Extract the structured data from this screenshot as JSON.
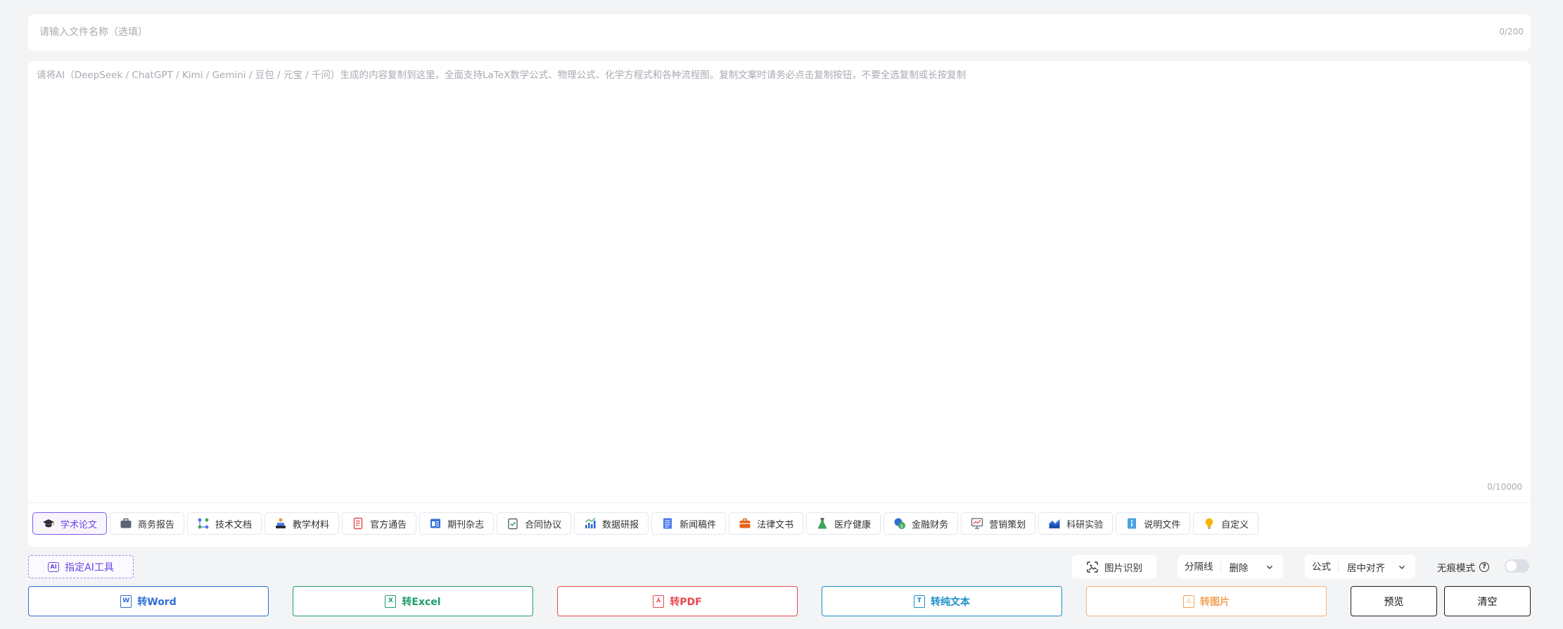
{
  "filename": {
    "placeholder": "请输入文件名称（选填）",
    "value": "",
    "counter": "0/200"
  },
  "content": {
    "placeholder": "请将AI（DeepSeek / ChatGPT / Kimi / Gemini / 豆包 / 元宝 / 千问）生成的内容复制到这里，全面支持LaTeX数学公式、物理公式、化学方程式和各种流程图。复制文案时请务必点击复制按钮，不要全选复制或长按复制",
    "value": "",
    "counter": "0/10000"
  },
  "templates": [
    {
      "label": "学术论文",
      "icon": "graduation-cap-icon",
      "active": true
    },
    {
      "label": "商务报告",
      "icon": "briefcase-icon",
      "active": false
    },
    {
      "label": "技术文档",
      "icon": "nodes-icon",
      "active": false
    },
    {
      "label": "教学材料",
      "icon": "podium-icon",
      "active": false
    },
    {
      "label": "官方通告",
      "icon": "notice-icon",
      "active": false
    },
    {
      "label": "期刊杂志",
      "icon": "magazine-icon",
      "active": false
    },
    {
      "label": "合同协议",
      "icon": "clipboard-check-icon",
      "active": false
    },
    {
      "label": "数据研报",
      "icon": "bar-chart-icon",
      "active": false
    },
    {
      "label": "新闻稿件",
      "icon": "newspaper-icon",
      "active": false
    },
    {
      "label": "法律文书",
      "icon": "legal-case-icon",
      "active": false
    },
    {
      "label": "医疗健康",
      "icon": "flask-icon",
      "active": false
    },
    {
      "label": "金融财务",
      "icon": "coins-icon",
      "active": false
    },
    {
      "label": "营销策划",
      "icon": "presentation-icon",
      "active": false
    },
    {
      "label": "科研实验",
      "icon": "area-chart-icon",
      "active": false
    },
    {
      "label": "说明文件",
      "icon": "info-doc-icon",
      "active": false
    },
    {
      "label": "自定义",
      "icon": "lightbulb-icon",
      "active": false
    }
  ],
  "controls": {
    "ai_tool_label": "指定AI工具",
    "ai_badge": "AI",
    "ocr_label": "图片识别",
    "divider_label": "分隔线",
    "divider_value": "删除",
    "formula_label": "公式",
    "formula_value": "居中对齐",
    "trace_mode_label": "无痕模式",
    "trace_mode_on": false
  },
  "convert": {
    "word": {
      "label": "转Word",
      "badge": "W",
      "color": "#2f6fd6"
    },
    "excel": {
      "label": "转Excel",
      "badge": "X",
      "color": "#1f9d6b"
    },
    "pdf": {
      "label": "转PDF",
      "badge": "⅄",
      "color": "#e5484d"
    },
    "text": {
      "label": "转纯文本",
      "badge": "T",
      "color": "#1b8fc9"
    },
    "image": {
      "label": "转图片",
      "badge": "◬",
      "color": "#f3a255"
    }
  },
  "actions": {
    "preview": "预览",
    "clear": "清空"
  },
  "colors": {
    "accent": "#6b46e6",
    "background": "#f3f4f6"
  }
}
